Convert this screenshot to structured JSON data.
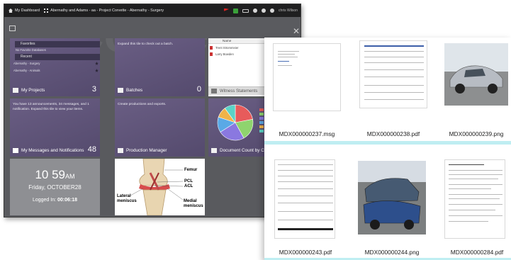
{
  "dashboard": {
    "breadcrumb": {
      "home": "My Dashboard",
      "project": "Abernathy and Adams - aa - Project Corvette - Abernathy - Surgery"
    },
    "user": "chris Wilson",
    "tiles": {
      "projects": {
        "favorites_label": "Favorites",
        "no_favorites": "No Favorite Databases",
        "recent_label": "Recent",
        "recent_items": [
          "Abernathy - Surgery",
          "Abernathy - Animals"
        ],
        "title": "My Projects",
        "count": "3"
      },
      "batches": {
        "text": "Expand this tile to check out a batch.",
        "title": "Batches",
        "count": "0"
      },
      "witness": {
        "col_name": "Name",
        "col_name2": "Name",
        "rows": [
          "Trent Strommeier",
          "Larry Bowden"
        ],
        "title": "Witness Statements"
      },
      "messages": {
        "text": "You have 13 announcements, 34 messages, and 1 notification. Expand this tile to view your items.",
        "title": "My Messages and Notifications",
        "count": "48"
      },
      "production": {
        "text": "Create productions and exports.",
        "title": "Production Manager"
      },
      "doccount": {
        "title": "Document Count by Cust"
      },
      "clock": {
        "time": "10 59",
        "ampm": "AM",
        "date": "Friday, OCTOBER28",
        "logged_label": "Logged In:",
        "logged_value": "00:06:18"
      },
      "anatomy": {
        "labels": [
          "Femur",
          "PCL",
          "ACL",
          "Lateral",
          "meniscus",
          "Medial",
          "meniscus"
        ]
      }
    },
    "pie": [
      {
        "value": 22,
        "color": "#e75b5b"
      },
      {
        "value": 20,
        "color": "#8fd46e"
      },
      {
        "value": 24,
        "color": "#8a78e0"
      },
      {
        "value": 14,
        "color": "#5aa9e6"
      },
      {
        "value": 10,
        "color": "#f0b34a"
      },
      {
        "value": 10,
        "color": "#5bd3c7"
      }
    ]
  },
  "files": {
    "items": [
      {
        "name": "MDX000000237.msg"
      },
      {
        "name": "MDX000000238.pdf"
      },
      {
        "name": "MDX000000239.png"
      },
      {
        "name": "MDX000000243.pdf"
      },
      {
        "name": "MDX000000244.png"
      },
      {
        "name": "MDX000000284.pdf"
      }
    ]
  }
}
